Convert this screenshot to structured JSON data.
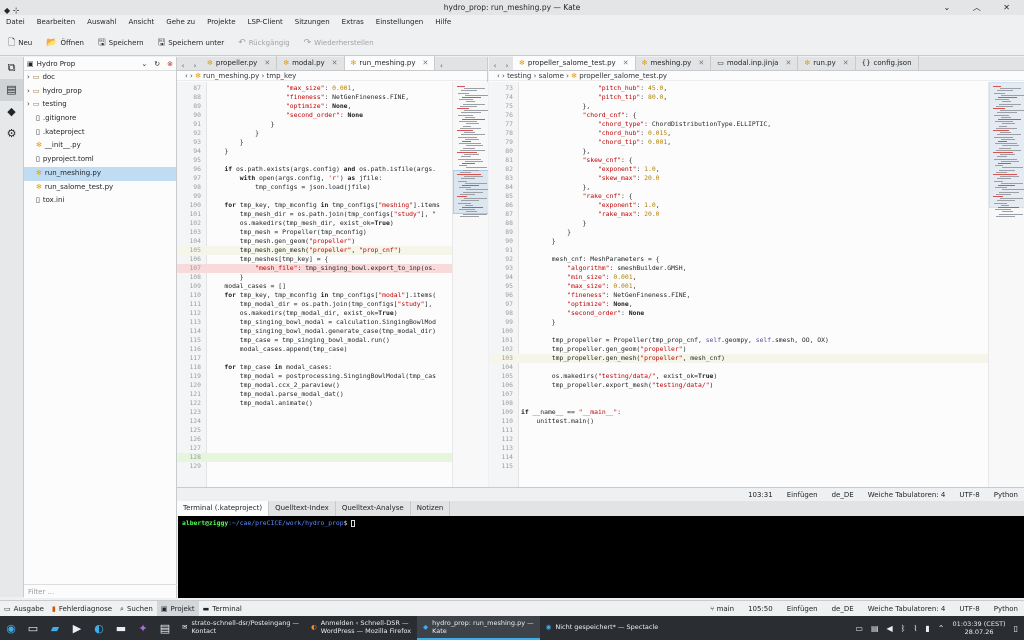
{
  "window": {
    "title": "hydro_prop: run_meshing.py — Kate"
  },
  "menu": [
    "Datei",
    "Bearbeiten",
    "Auswahl",
    "Ansicht",
    "Gehe zu",
    "Projekte",
    "LSP-Client",
    "Sitzungen",
    "Extras",
    "Einstellungen",
    "Hilfe"
  ],
  "toolbar": {
    "new": "Neu",
    "open": "Öffnen",
    "save": "Speichern",
    "save_as": "Speichern unter",
    "undo": "Rückgängig",
    "redo": "Wiederherstellen"
  },
  "project": {
    "name": "Hydro Prop",
    "filter_placeholder": "Filter ...",
    "items": [
      {
        "label": "doc",
        "type": "folder"
      },
      {
        "label": "hydro_prop",
        "type": "folder"
      },
      {
        "label": "testing",
        "type": "folder"
      },
      {
        "label": ".gitignore",
        "type": "file"
      },
      {
        "label": ".kateproject",
        "type": "file"
      },
      {
        "label": "__init__.py",
        "type": "py"
      },
      {
        "label": "pyproject.toml",
        "type": "file"
      },
      {
        "label": "run_meshing.py",
        "type": "py",
        "selected": true
      },
      {
        "label": "run_salome_test.py",
        "type": "py"
      },
      {
        "label": "tox.ini",
        "type": "file"
      }
    ]
  },
  "left_tabs": [
    {
      "label": "propeller.py"
    },
    {
      "label": "modal.py"
    },
    {
      "label": "run_meshing.py",
      "active": true
    }
  ],
  "left_crumb": [
    "run_meshing.py",
    "tmp_key"
  ],
  "right_tabs": [
    {
      "label": "propeller_salome_test.py",
      "active": true
    },
    {
      "label": "meshing.py"
    },
    {
      "label": "modal.inp.jinja"
    },
    {
      "label": "run.py"
    },
    {
      "label": "config.json"
    }
  ],
  "right_crumb": [
    "testing",
    "salome",
    "propeller_salome_test.py"
  ],
  "left_code": [
    {
      "n": "87",
      "t": "                    \"max_size\": 0.001,"
    },
    {
      "n": "88",
      "t": "                    \"fineness\": NetGenFineness.FINE,"
    },
    {
      "n": "89",
      "t": "                    \"optimize\": None,"
    },
    {
      "n": "90",
      "t": "                    \"second_order\": None"
    },
    {
      "n": "91",
      "t": "                }"
    },
    {
      "n": "92",
      "t": "            }"
    },
    {
      "n": "93",
      "t": "        }"
    },
    {
      "n": "94",
      "t": "    }"
    },
    {
      "n": "95",
      "t": ""
    },
    {
      "n": "96",
      "t": "    if os.path.exists(args.config) and os.path.isfile(args."
    },
    {
      "n": "97",
      "t": "        with open(args.config, 'r') as jfile:"
    },
    {
      "n": "98",
      "t": "            tmp_configs = json.load(jfile)"
    },
    {
      "n": "99",
      "t": ""
    },
    {
      "n": "100",
      "t": "    for tmp_key, tmp_mconfig in tmp_configs[\"meshing\"].items"
    },
    {
      "n": "101",
      "t": "        tmp_mesh_dir = os.path.join(tmp_configs[\"study\"], \""
    },
    {
      "n": "102",
      "t": "        os.makedirs(tmp_mesh_dir, exist_ok=True)"
    },
    {
      "n": "103",
      "t": "        tmp_mesh = Propeller(tmp_mconfig)"
    },
    {
      "n": "104",
      "t": "        tmp_mesh.gen_geom(\"propeller\")"
    },
    {
      "n": "105",
      "t": "        tmp_mesh.gen_mesh(\"propeller\", \"prop_cnf\")",
      "hl": "cur"
    },
    {
      "n": "106",
      "t": "        tmp_meshes[tmp_key] = {"
    },
    {
      "n": "107",
      "t": "            \"mesh_file\": tmp_singing_bowl.export_to_inp(os.",
      "hl": "err"
    },
    {
      "n": "108",
      "t": "        }"
    },
    {
      "n": "109",
      "t": "    modal_cases = []"
    },
    {
      "n": "110",
      "t": "    for tmp_key, tmp_mconfig in tmp_configs[\"modal\"].items("
    },
    {
      "n": "111",
      "t": "        tmp_modal_dir = os.path.join(tmp_configs[\"study\"],"
    },
    {
      "n": "112",
      "t": "        os.makedirs(tmp_modal_dir, exist_ok=True)"
    },
    {
      "n": "113",
      "t": "        tmp_singing_bowl_modal = calculation.SingingBowlMod"
    },
    {
      "n": "114",
      "t": "        tmp_singing_bowl_modal.generate_case(tmp_modal_dir)"
    },
    {
      "n": "115",
      "t": "        tmp_case = tmp_singing_bowl_modal.run()"
    },
    {
      "n": "116",
      "t": "        modal_cases.append(tmp_case)"
    },
    {
      "n": "117",
      "t": ""
    },
    {
      "n": "118",
      "t": "    for tmp_case in modal_cases:"
    },
    {
      "n": "119",
      "t": "        tmp_modal = postprocessing.SingingBowlModal(tmp_cas"
    },
    {
      "n": "120",
      "t": "        tmp_modal.ccx_2_paraview()"
    },
    {
      "n": "121",
      "t": "        tmp_modal.parse_modal_dat()"
    },
    {
      "n": "122",
      "t": "        tmp_modal.animate()"
    },
    {
      "n": "123",
      "t": ""
    },
    {
      "n": "124",
      "t": ""
    },
    {
      "n": "125",
      "t": ""
    },
    {
      "n": "126",
      "t": ""
    },
    {
      "n": "127",
      "t": ""
    },
    {
      "n": "128",
      "t": "",
      "hl": "green"
    },
    {
      "n": "129",
      "t": ""
    }
  ],
  "right_code": [
    {
      "n": "73",
      "t": "                    \"pitch_hub\": 45.0,"
    },
    {
      "n": "74",
      "t": "                    \"pitch_tip\": 80.0,"
    },
    {
      "n": "75",
      "t": "                },"
    },
    {
      "n": "76",
      "t": "                \"chord_cnf\": {"
    },
    {
      "n": "77",
      "t": "                    \"chord_type\": ChordDistributionType.ELLIPTIC,"
    },
    {
      "n": "78",
      "t": "                    \"chord_hub\": 0.015,"
    },
    {
      "n": "79",
      "t": "                    \"chord_tip\": 0.001,"
    },
    {
      "n": "80",
      "t": "                },"
    },
    {
      "n": "81",
      "t": "                \"skew_cnf\": {"
    },
    {
      "n": "82",
      "t": "                    \"exponent\": 1.0,"
    },
    {
      "n": "83",
      "t": "                    \"skew_max\": 20.0"
    },
    {
      "n": "84",
      "t": "                },"
    },
    {
      "n": "85",
      "t": "                \"rake_cnf\": {"
    },
    {
      "n": "86",
      "t": "                    \"exponent\": 1.0,"
    },
    {
      "n": "87",
      "t": "                    \"rake_max\": 20.0"
    },
    {
      "n": "88",
      "t": "                }"
    },
    {
      "n": "89",
      "t": "            }"
    },
    {
      "n": "90",
      "t": "        }"
    },
    {
      "n": "91",
      "t": ""
    },
    {
      "n": "92",
      "t": "        mesh_cnf: MeshParameters = {"
    },
    {
      "n": "93",
      "t": "            \"algorithm\": smeshBuilder.GMSH,"
    },
    {
      "n": "94",
      "t": "            \"min_size\": 0.001,"
    },
    {
      "n": "95",
      "t": "            \"max_size\": 0.001,"
    },
    {
      "n": "96",
      "t": "            \"fineness\": NetGenFineness.FINE,"
    },
    {
      "n": "97",
      "t": "            \"optimize\": None,"
    },
    {
      "n": "98",
      "t": "            \"second_order\": None"
    },
    {
      "n": "99",
      "t": "        }"
    },
    {
      "n": "100",
      "t": ""
    },
    {
      "n": "101",
      "t": "        tmp_propeller = Propeller(tmp_prop_cnf, self.geompy, self.smesh, OO, OX)"
    },
    {
      "n": "102",
      "t": "        tmp_propeller.gen_geom(\"propeller\")"
    },
    {
      "n": "103",
      "t": "        tmp_propeller.gen_mesh(\"propeller\", mesh_cnf)",
      "hl": "cur"
    },
    {
      "n": "104",
      "t": ""
    },
    {
      "n": "105",
      "t": "        os.makedirs(\"testing/data/\", exist_ok=True)"
    },
    {
      "n": "106",
      "t": "        tmp_propeller.export_mesh(\"testing/data/\")"
    },
    {
      "n": "107",
      "t": ""
    },
    {
      "n": "108",
      "t": ""
    },
    {
      "n": "109",
      "t": "if __name__ == \"__main__\":"
    },
    {
      "n": "110",
      "t": "    unittest.main()"
    },
    {
      "n": "111",
      "t": ""
    },
    {
      "n": "112",
      "t": ""
    },
    {
      "n": "113",
      "t": ""
    },
    {
      "n": "114",
      "t": ""
    },
    {
      "n": "115",
      "t": ""
    }
  ],
  "status": {
    "position": "103:31",
    "mode": "Einfügen",
    "lang_dict": "de_DE",
    "indent": "Weiche Tabulatoren: 4",
    "encoding": "UTF-8",
    "syntax": "Python"
  },
  "terminal_tabs": [
    {
      "label": "Terminal (.kateproject)",
      "active": true
    },
    {
      "label": "Quelltext-Index"
    },
    {
      "label": "Quelltext-Analyse"
    },
    {
      "label": "Notizen"
    }
  ],
  "terminal": {
    "user": "albert@ziggy",
    "path": ":~/cae/preCICE/work/hydro_prop",
    "prompt": "$"
  },
  "bottom": {
    "tabs": [
      "Ausgabe",
      "Fehlerdiagnose",
      "Suchen",
      "Projekt",
      "Terminal"
    ],
    "branch": "main",
    "position": "105:50",
    "mode": "Einfügen",
    "lang_dict": "de_DE",
    "indent": "Weiche Tabulatoren: 4",
    "encoding": "UTF-8",
    "syntax": "Python"
  },
  "taskbar": {
    "tasks": [
      {
        "line1": "strato-schnell-dsr/Posteingang —",
        "line2": "Kontact"
      },
      {
        "line1": "Anmelden ‹ Schnell-DSR —",
        "line2": "WordPress — Mozilla Firefox"
      },
      {
        "line1": "hydro_prop: run_meshing.py —",
        "line2": "Kate",
        "active": true
      },
      {
        "line1": "Nicht gespeichert* — Spectacle",
        "line2": ""
      }
    ],
    "time": "01:03:39",
    "tz": "(CEST)",
    "date": "28.07.26"
  }
}
